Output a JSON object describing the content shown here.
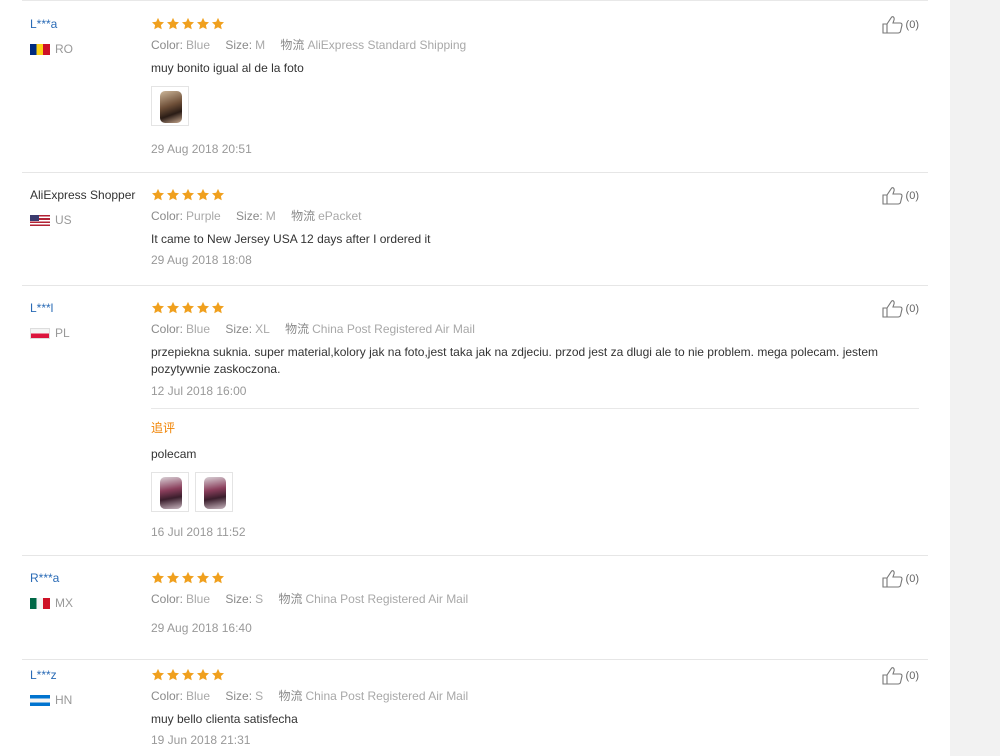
{
  "labels": {
    "color": "Color:",
    "size": "Size:",
    "shipping": "物流"
  },
  "reviews": [
    {
      "user": "L***a",
      "country": "RO",
      "stars": 5,
      "color": "Blue",
      "size": "M",
      "shipping": "AliExpress Standard Shipping",
      "text": "muy bonito igual al de la foto",
      "date": "29 Aug 2018 20:51",
      "helpful": "(0)"
    },
    {
      "user": "AliExpress Shopper",
      "country": "US",
      "stars": 5,
      "color": "Purple",
      "size": "M",
      "shipping": "ePacket",
      "text": "It came to New Jersey USA 12 days after I ordered it",
      "date": "29 Aug 2018 18:08",
      "helpful": "(0)"
    },
    {
      "user": "L***l",
      "country": "PL",
      "stars": 5,
      "color": "Blue",
      "size": "XL",
      "shipping": "China Post Registered Air Mail",
      "text": "przepiekna suknia. super material,kolory jak na foto,jest taka jak na zdjeciu. przod jest za dlugi ale to nie problem. mega polecam. jestem pozytywnie zaskoczona.",
      "date": "12 Jul 2018 16:00",
      "helpful": "(0)",
      "followup": {
        "title": "追评",
        "text": "polecam",
        "date": "16 Jul 2018 11:52"
      }
    },
    {
      "user": "R***a",
      "country": "MX",
      "stars": 5,
      "color": "Blue",
      "size": "S",
      "shipping": "China Post Registered Air Mail",
      "text": "",
      "date": "29 Aug 2018 16:40",
      "helpful": "(0)"
    },
    {
      "user": "L***z",
      "country": "HN",
      "stars": 5,
      "color": "Blue",
      "size": "S",
      "shipping": "China Post Registered Air Mail",
      "text": "muy bello clienta satisfecha",
      "date": "19 Jun 2018 21:31",
      "helpful": "(0)"
    }
  ],
  "icons": {
    "star": "star-icon",
    "helpful": "thumbs-up-icon"
  },
  "colors": {
    "star": "#f0a01e",
    "username": "#2a6bb6",
    "followup": "#f08200"
  }
}
